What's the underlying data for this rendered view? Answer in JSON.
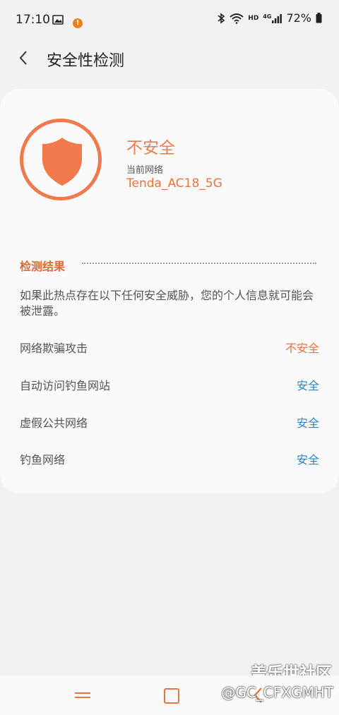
{
  "status_bar": {
    "time": "17:10",
    "icons_left": [
      "image-icon",
      "alert-icon"
    ],
    "icons_right": [
      "bluetooth-icon",
      "wifi-icon",
      "hd-icon",
      "4g-signal-icon",
      "battery-icon"
    ],
    "hd_label": "HD",
    "network_label": "4G",
    "battery": "72%"
  },
  "header": {
    "title": "安全性检测"
  },
  "summary": {
    "status": "不安全",
    "network_label": "当前网络",
    "network_name": "Tenda_AC18_5G",
    "accent_color": "#f07a4c"
  },
  "results": {
    "section_title": "检测结果",
    "description": "如果此热点存在以下任何安全威胁，您的个人信息就可能会被泄露。",
    "items": [
      {
        "name": "网络欺骗攻击",
        "status": "不安全"
      },
      {
        "name": "自动访问钓鱼网站",
        "status": "安全"
      },
      {
        "name": "虚假公共网络",
        "status": "安全"
      },
      {
        "name": "钓鱼网络",
        "status": "安全"
      }
    ]
  },
  "watermark": {
    "line1": "盖乐世社区",
    "line2": "@GC_CFXGMHT"
  }
}
